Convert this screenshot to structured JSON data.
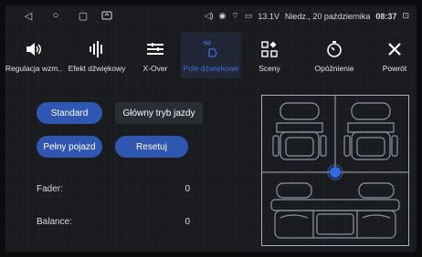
{
  "status_bar": {
    "voltage": "13.1V",
    "date": "Niedz., 20 października",
    "time": "08:37"
  },
  "tabs": [
    {
      "label": "Regulacja wzm..",
      "icon": "speaker-volume-icon"
    },
    {
      "label": "Efekt dźwiękowy",
      "icon": "equalizer-icon"
    },
    {
      "label": "X-Over",
      "icon": "crossover-icon"
    },
    {
      "label": "Pole dźwiękowe",
      "icon": "sound-field-icon",
      "active": true
    },
    {
      "label": "Sceny",
      "icon": "scenes-icon"
    },
    {
      "label": "Opóźnienie",
      "icon": "delay-icon"
    },
    {
      "label": "Powrót",
      "icon": "close-icon"
    }
  ],
  "buttons": {
    "standard": "Standard",
    "driving_mode": "Główny tryb jazdy",
    "full_vehicle": "Pełny pojazd",
    "reset": "Resetuj"
  },
  "settings": {
    "fader_label": "Fader:",
    "fader_value": "0",
    "balance_label": "Balance:",
    "balance_value": "0"
  },
  "colors": {
    "accent": "#2f56b0",
    "active_tab": "#3a6fd8",
    "handle": "#2f6ae0"
  }
}
